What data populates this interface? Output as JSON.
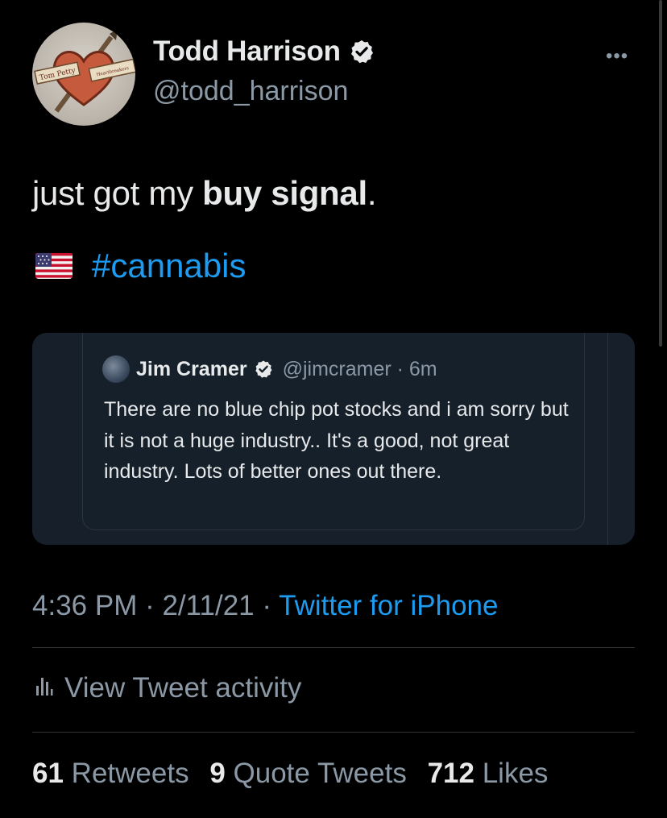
{
  "author": {
    "display_name": "Todd Harrison",
    "handle": "@todd_harrison",
    "avatar_text_left": "Tom Petty",
    "avatar_text_right": "Heartbreakers",
    "verified": true
  },
  "tweet": {
    "text_plain_start": "just got my ",
    "text_bold": "buy signal",
    "text_plain_end": ".",
    "flag_emoji": "us-flag-icon",
    "hashtag": "#cannabis"
  },
  "quote": {
    "display_name": "Jim Cramer",
    "handle": "@jimcramer",
    "time": "6m",
    "text": "There are no blue chip pot stocks and i am sorry but it is not a huge industry.. It's a good, not great industry. Lots of better ones out there."
  },
  "meta": {
    "time": "4:36 PM",
    "date": "2/11/21",
    "source": "Twitter for iPhone"
  },
  "activity": {
    "label": "View Tweet activity"
  },
  "stats": {
    "retweets_count": "61",
    "retweets_label": "Retweets",
    "quotes_count": "9",
    "quotes_label": "Quote Tweets",
    "likes_count": "712",
    "likes_label": "Likes"
  },
  "colors": {
    "background": "#000000",
    "text_primary": "#e7e9ea",
    "text_secondary": "#8b98a5",
    "accent": "#1d9bf0",
    "quote_background": "#15202b"
  }
}
